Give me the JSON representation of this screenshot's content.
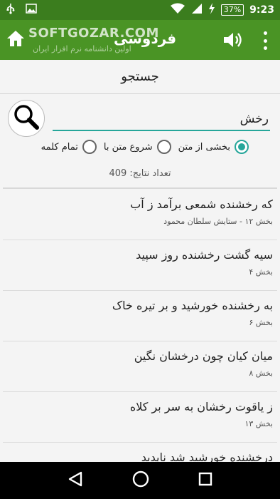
{
  "status_bar": {
    "battery": "37%",
    "time": "9:23"
  },
  "app_bar": {
    "title": "فردوسی",
    "watermark": "SOFTGOZAR.COM",
    "watermark_sub": "اولین دانشنامه نرم افزار ایران"
  },
  "search": {
    "header": "جستجو",
    "query": "رخش",
    "options": [
      {
        "label": "بخشی از متن",
        "checked": true
      },
      {
        "label": "شروع متن با",
        "checked": false
      },
      {
        "label": "تمام کلمه",
        "checked": false
      }
    ],
    "result_count": "تعداد نتایج: 409"
  },
  "results": [
    {
      "verse": "که رخشنده شمعی برآمد ز آب",
      "section": "بخش ۱۲ - ستایش سلطان محمود"
    },
    {
      "verse": "سیه گشت رخشنده روز سپید",
      "section": "بخش ۴"
    },
    {
      "verse": "به رخشنده خورشید و بر تیره خاک",
      "section": "بخش ۶"
    },
    {
      "verse": "میان کیان چون درخشان نگین",
      "section": "بخش ۸"
    },
    {
      "verse": "ز یاقوت رخشان به سر بر کلاه",
      "section": "بخش ۱۳"
    },
    {
      "verse": "درخشنده خورشید شد ناپدید",
      "section": ""
    }
  ],
  "colors": {
    "status_bar": "#3b7d1e",
    "app_bar": "#4a9425",
    "accent": "#26a69a"
  }
}
